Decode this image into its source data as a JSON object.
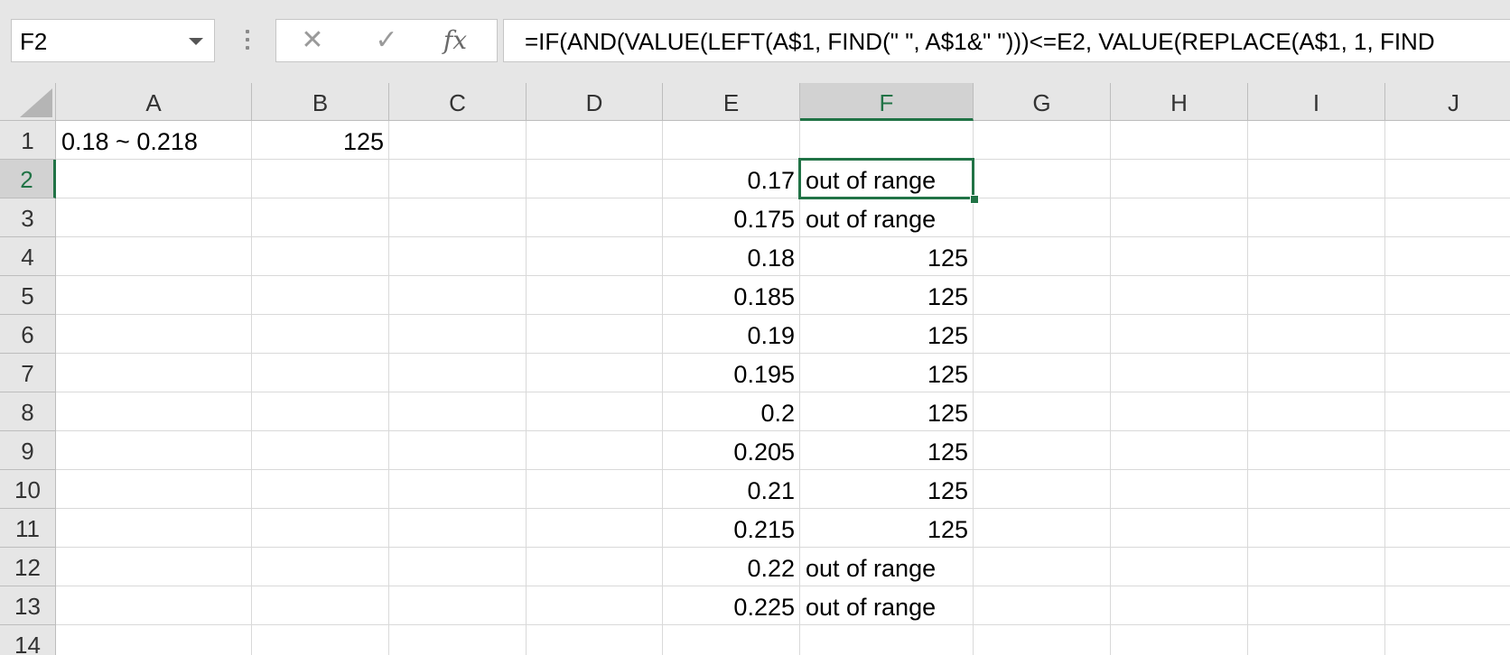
{
  "name_box": {
    "value": "F2"
  },
  "formula_bar": {
    "cancel_glyph": "✕",
    "enter_glyph": "✓",
    "fx_label": "fx",
    "formula": "=IF(AND(VALUE(LEFT(A$1, FIND(\" \", A$1&\" \")))<=E2, VALUE(REPLACE(A$1, 1, FIND"
  },
  "columns": [
    "A",
    "B",
    "C",
    "D",
    "E",
    "F",
    "G",
    "H",
    "I",
    "J"
  ],
  "rows": [
    "1",
    "2",
    "3",
    "4",
    "5",
    "6",
    "7",
    "8",
    "9",
    "10",
    "11",
    "12",
    "13",
    "14"
  ],
  "selected_cell": {
    "column": "F",
    "row": "2"
  },
  "cells": {
    "A1": "0.18 ~ 0.218",
    "B1": "125",
    "E2": "0.17",
    "F2": "out of range",
    "E3": "0.175",
    "F3": "out of range",
    "E4": "0.18",
    "F4": "125",
    "E5": "0.185",
    "F5": "125",
    "E6": "0.19",
    "F6": "125",
    "E7": "0.195",
    "F7": "125",
    "E8": "0.2",
    "F8": "125",
    "E9": "0.205",
    "F9": "125",
    "E10": "0.21",
    "F10": "125",
    "E11": "0.215",
    "F11": "125",
    "E12": "0.22",
    "F12": "out of range",
    "E13": "0.225",
    "F13": "out of range"
  },
  "colors": {
    "accent": "#217346",
    "header_bg": "#e6e6e6",
    "gridline": "#d9d9d9"
  },
  "icons": {
    "name_box_dropdown": "chevron-down-icon",
    "cancel": "close-icon",
    "enter": "check-icon",
    "insert_function": "fx-icon"
  }
}
